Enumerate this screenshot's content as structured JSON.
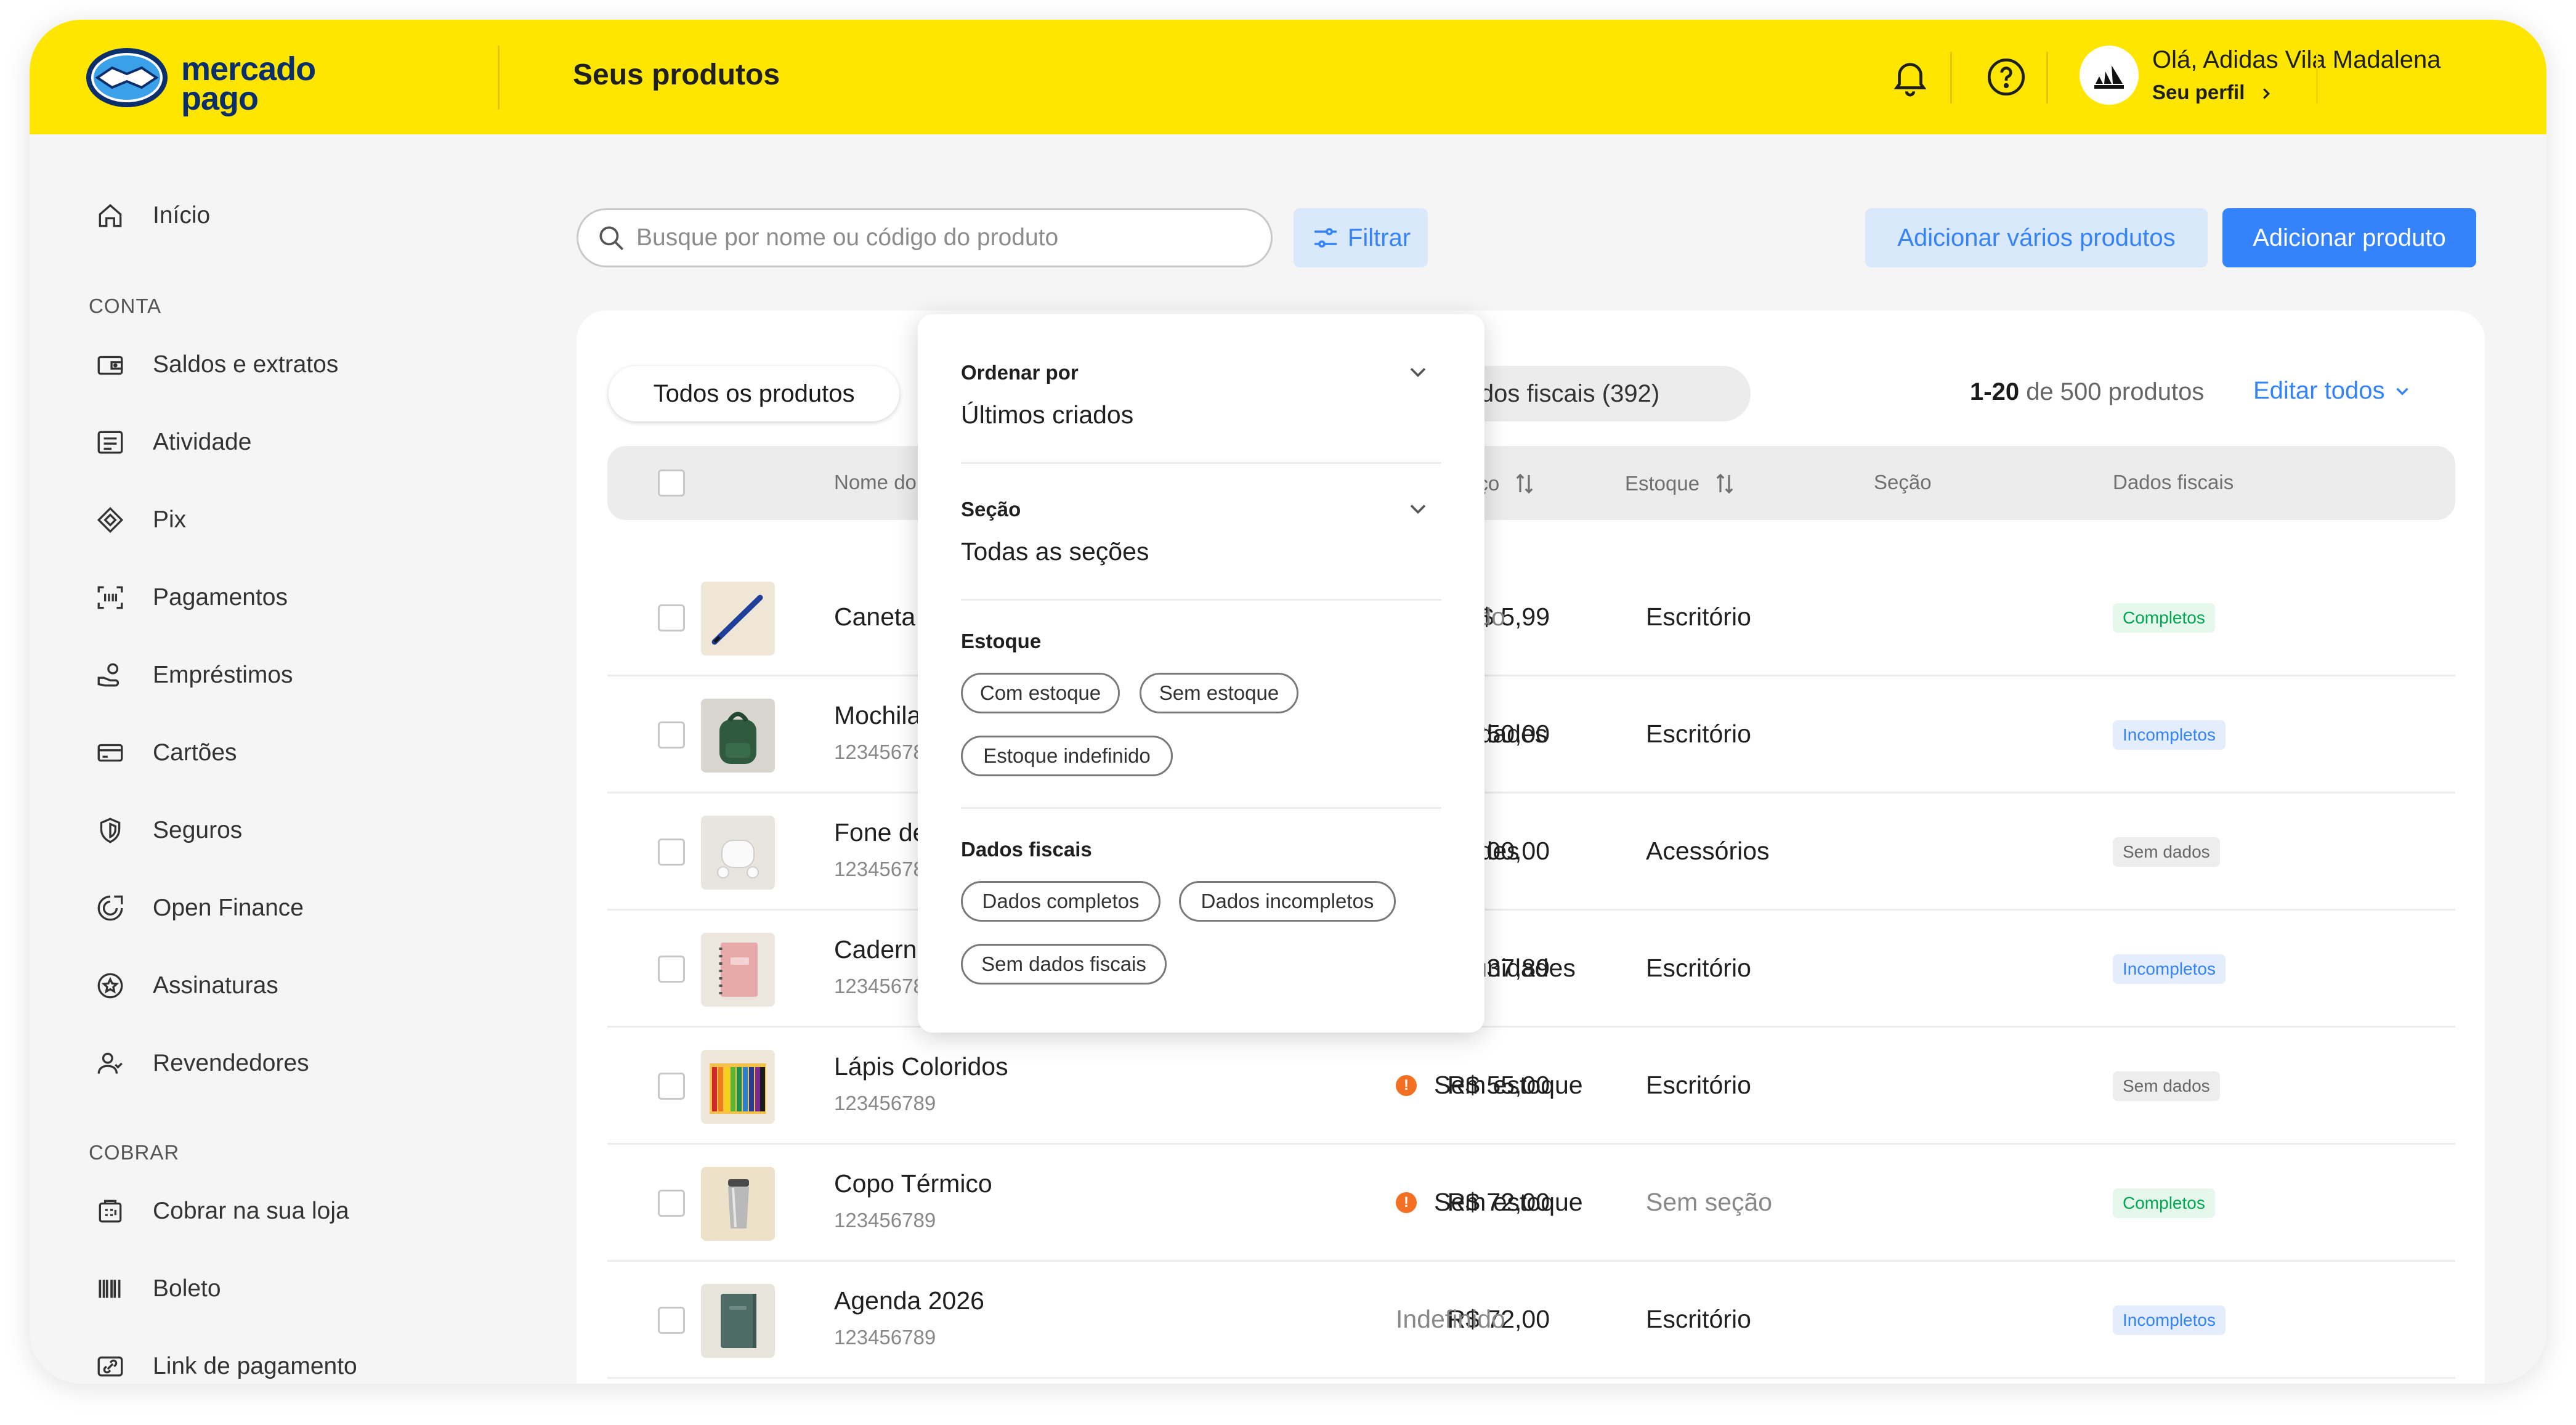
{
  "header": {
    "logo_text_line1": "mercado",
    "logo_text_line2": "pago",
    "page_title": "Seus produtos",
    "greeting": "Olá, Adidas Vila Madalena",
    "profile_link": "Seu perfil"
  },
  "sidebar": {
    "home": "Início",
    "section_conta": "CONTA",
    "conta_items": [
      "Saldos e extratos",
      "Atividade",
      "Pix",
      "Pagamentos",
      "Empréstimos",
      "Cartões",
      "Seguros",
      "Open Finance",
      "Assinaturas",
      "Revendedores"
    ],
    "section_cobrar": "COBRAR",
    "cobrar_items": [
      "Cobrar na sua loja",
      "Boleto",
      "Link de pagamento"
    ]
  },
  "toolbar": {
    "search_placeholder": "Busque por nome ou código do produto",
    "filter_label": "Filtrar",
    "add_many_label": "Adicionar vários produtos",
    "add_one_label": "Adicionar produto"
  },
  "tabs": {
    "all_products": "Todos os produtos",
    "no_fiscal_visible": "m dados fiscais (392)"
  },
  "pagination": {
    "range": "1-20",
    "total": "de 500 produtos"
  },
  "edit_all_label": "Editar todos",
  "table": {
    "headers": {
      "name": "Nome do produto",
      "price": "Preço",
      "stock": "Estoque",
      "section": "Seção",
      "fiscal": "Dados fiscais"
    },
    "rows": [
      {
        "name": "Caneta",
        "code": "",
        "price": "R$ 5,99",
        "stock": "Indefinido",
        "stock_alert": false,
        "section": "Escritório",
        "fiscal": "Completos",
        "fiscal_kind": "green",
        "thumb": "pen"
      },
      {
        "name": "Mochila",
        "code": "123456789",
        "price": "R$ 250,00",
        "stock": "180 unidades",
        "stock_alert": false,
        "section": "Escritório",
        "fiscal": "Incompletos",
        "fiscal_kind": "blue",
        "thumb": "backpack"
      },
      {
        "name": "Fone de ouvido",
        "code": "123456789",
        "price": "R$ 100,00",
        "stock": "9 unidades",
        "stock_alert": false,
        "section": "Acessórios",
        "fiscal": "Sem dados",
        "fiscal_kind": "grey",
        "thumb": "earbuds"
      },
      {
        "name": "Caderno",
        "code": "123456789",
        "price": "R$ 37,89",
        "stock": "99999 unidades",
        "stock_alert": false,
        "section": "Escritório",
        "fiscal": "Incompletos",
        "fiscal_kind": "blue",
        "thumb": "notebook"
      },
      {
        "name": "Lápis Coloridos",
        "code": "123456789",
        "price": "R$ 55,00",
        "stock": "Sem estoque",
        "stock_alert": true,
        "section": "Escritório",
        "fiscal": "Sem dados",
        "fiscal_kind": "grey",
        "thumb": "pencils"
      },
      {
        "name": "Copo Térmico",
        "code": "123456789",
        "price": "R$ 72,00",
        "stock": "Sem estoque",
        "stock_alert": true,
        "section": "Sem seção",
        "fiscal": "Completos",
        "fiscal_kind": "green",
        "thumb": "cup"
      },
      {
        "name": "Agenda 2026",
        "code": "123456789",
        "price": "R$ 72,00",
        "stock": "Indefinido",
        "stock_alert": false,
        "section": "Escritório",
        "fiscal": "Incompletos",
        "fiscal_kind": "blue",
        "thumb": "planner"
      }
    ]
  },
  "filter_panel": {
    "order_label": "Ordenar por",
    "order_value": "Últimos criados",
    "section_label": "Seção",
    "section_value": "Todas as seções",
    "stock_label": "Estoque",
    "stock_chips": [
      "Com estoque",
      "Sem estoque",
      "Estoque indefinido"
    ],
    "fiscal_label": "Dados fiscais",
    "fiscal_chips": [
      "Dados completos",
      "Dados incompletos",
      "Sem dados fiscais"
    ]
  },
  "colors": {
    "brand_yellow": "#ffe600",
    "brand_blue": "#3483fa",
    "logo_navy": "#0b2e6d",
    "alert_orange": "#f36f21",
    "badge_green": "#00a650"
  }
}
